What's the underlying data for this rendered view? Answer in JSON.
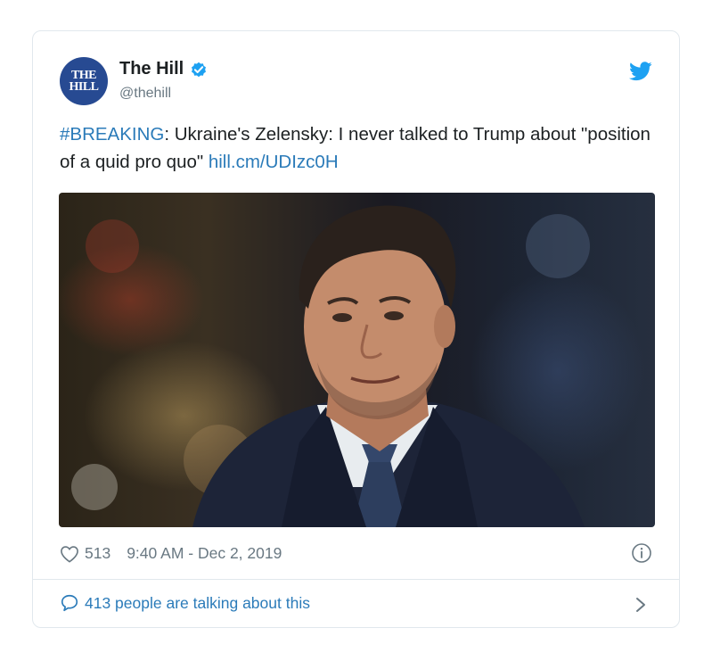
{
  "account": {
    "avatar_text": "THE HILL",
    "name": "The Hill",
    "handle": "@thehill"
  },
  "tweet": {
    "hashtag": "#BREAKING",
    "text": ": Ukraine's Zelensky: I never talked to Trump about \"position of a quid pro quo\" ",
    "link": "hill.cm/UDIzc0H"
  },
  "meta": {
    "likes": "513",
    "timestamp": "9:40 AM - Dec 2, 2019"
  },
  "footer": {
    "talking": "413 people are talking about this"
  },
  "colors": {
    "link": "#2b7bb9",
    "meta_gray": "#697882",
    "verified": "#1da1f2",
    "avatar_bg": "#274a92"
  },
  "icons": [
    "verified-badge-icon",
    "twitter-bird-icon",
    "heart-icon",
    "info-icon",
    "speech-bubble-icon",
    "chevron-right-icon"
  ]
}
